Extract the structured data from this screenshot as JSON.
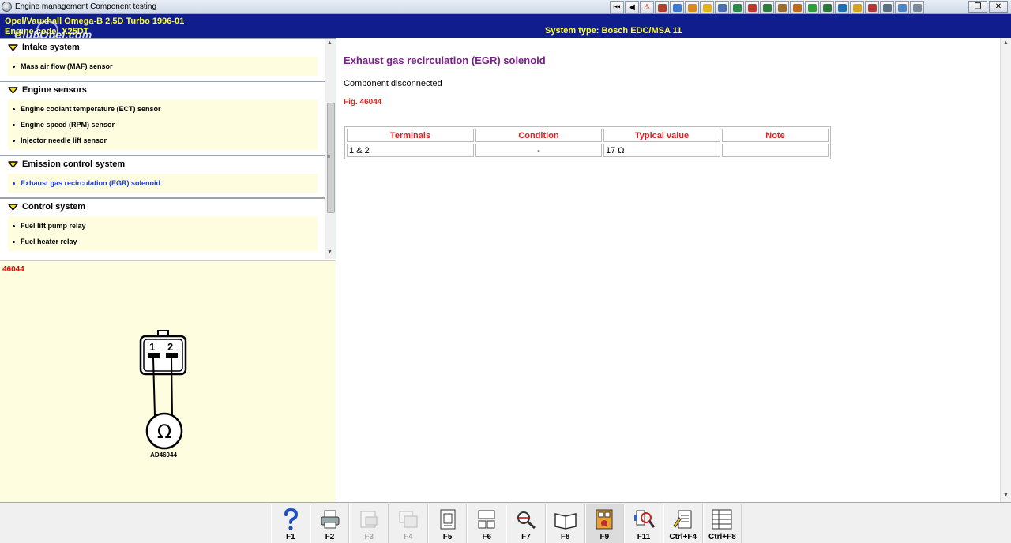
{
  "window": {
    "title": "Engine management Component testing",
    "toolbar_icons": [
      {
        "name": "first-icon",
        "glyph": "⏮",
        "color": "#000000"
      },
      {
        "name": "back-icon",
        "glyph": "◀",
        "color": "#000000"
      },
      {
        "name": "warning-icon",
        "glyph": "⚠",
        "color": "#cc0000"
      },
      {
        "name": "manual-icon",
        "glyph": "",
        "color": "#b0402a"
      },
      {
        "name": "wiring-icon",
        "glyph": "",
        "color": "#3b7bd6"
      },
      {
        "name": "engine-icon",
        "glyph": "",
        "color": "#d98a1e"
      },
      {
        "name": "tools-icon",
        "glyph": "",
        "color": "#e1b414"
      },
      {
        "name": "wheel-icon",
        "glyph": "",
        "color": "#4a6fb5"
      },
      {
        "name": "diagram-icon",
        "glyph": "",
        "color": "#2a8a4a"
      },
      {
        "name": "service-icon",
        "glyph": "",
        "color": "#c0392b"
      },
      {
        "name": "lift-icon",
        "glyph": "",
        "color": "#2f7d3a"
      },
      {
        "name": "car-icon",
        "glyph": "",
        "color": "#9c6b2e"
      },
      {
        "name": "tune-icon",
        "glyph": "",
        "color": "#c06a1a"
      },
      {
        "name": "electrics-icon",
        "glyph": "",
        "color": "#2e9e3a"
      },
      {
        "name": "battery-icon",
        "glyph": "",
        "color": "#2b7a3a"
      },
      {
        "name": "timing-icon",
        "glyph": "",
        "color": "#1f6fb5"
      },
      {
        "name": "key-icon",
        "glyph": "",
        "color": "#d6a31c"
      },
      {
        "name": "print-icon",
        "glyph": "",
        "color": "#b33a3a"
      },
      {
        "name": "globe-icon",
        "glyph": "",
        "color": "#5a6f7f"
      },
      {
        "name": "airbag-icon",
        "glyph": "",
        "color": "#4a86c5"
      },
      {
        "name": "cable-icon",
        "glyph": "",
        "color": "#7a8a9a"
      }
    ],
    "controls": {
      "restore": "❐",
      "close": "✕"
    }
  },
  "info": {
    "vehicle": "Opel/Vauxhall  Omega-B  2,5D Turbo 1996-01",
    "engine": "Engine code: X25DT",
    "system_type": "System type: Bosch EDC/MSA 11",
    "watermark": "ClubOpel.com"
  },
  "sidebar": {
    "groups": [
      {
        "title": "Intake system",
        "items": [
          {
            "label": "Mass air flow (MAF) sensor",
            "active": false
          }
        ]
      },
      {
        "title": "Engine sensors",
        "items": [
          {
            "label": "Engine coolant temperature (ECT) sensor",
            "active": false
          },
          {
            "label": "Engine speed (RPM) sensor",
            "active": false
          },
          {
            "label": "Injector needle lift sensor",
            "active": false
          }
        ]
      },
      {
        "title": "Emission control system",
        "items": [
          {
            "label": "Exhaust gas recirculation (EGR) solenoid",
            "active": true
          }
        ]
      },
      {
        "title": "Control system",
        "items": [
          {
            "label": "Fuel lift pump relay",
            "active": false
          },
          {
            "label": "Fuel heater relay",
            "active": false
          }
        ]
      }
    ],
    "scroll_up": "▲",
    "scroll_down": "▼",
    "scroll_grip": "≡"
  },
  "diagram": {
    "fig_number": "46044",
    "pin_labels": [
      "1",
      "2"
    ],
    "symbol": "Ω",
    "caption": "AD46044"
  },
  "content": {
    "heading": "Exhaust gas recirculation (EGR) solenoid",
    "status": "Component disconnected",
    "fig_ref": "Fig. 46044",
    "table": {
      "headers": [
        "Terminals",
        "Condition",
        "Typical value",
        "Note"
      ],
      "rows": [
        [
          "1 & 2",
          "-",
          "17 Ω",
          ""
        ]
      ]
    },
    "scroll_up": "▲",
    "scroll_down": "▼"
  },
  "fbar": {
    "keys": [
      {
        "label": "F1",
        "icon": "help-icon",
        "disabled": false,
        "pressed": false
      },
      {
        "label": "F2",
        "icon": "printer-icon",
        "disabled": false,
        "pressed": false
      },
      {
        "label": "F3",
        "icon": "camera-doc-icon",
        "disabled": true,
        "pressed": false
      },
      {
        "label": "F4",
        "icon": "images-icon",
        "disabled": true,
        "pressed": false
      },
      {
        "label": "F5",
        "icon": "document-icon",
        "disabled": false,
        "pressed": false
      },
      {
        "label": "F6",
        "icon": "connector-icon",
        "disabled": false,
        "pressed": false
      },
      {
        "label": "F7",
        "icon": "probe-icon",
        "disabled": false,
        "pressed": false
      },
      {
        "label": "F8",
        "icon": "book-icon",
        "disabled": false,
        "pressed": false
      },
      {
        "label": "F9",
        "icon": "component-icon",
        "disabled": false,
        "pressed": true
      },
      {
        "label": "F11",
        "icon": "search-map-icon",
        "disabled": false,
        "pressed": false
      },
      {
        "label": "Ctrl+F4",
        "icon": "notes-icon",
        "disabled": false,
        "pressed": false
      },
      {
        "label": "Ctrl+F8",
        "icon": "list-icon",
        "disabled": false,
        "pressed": false
      }
    ]
  }
}
